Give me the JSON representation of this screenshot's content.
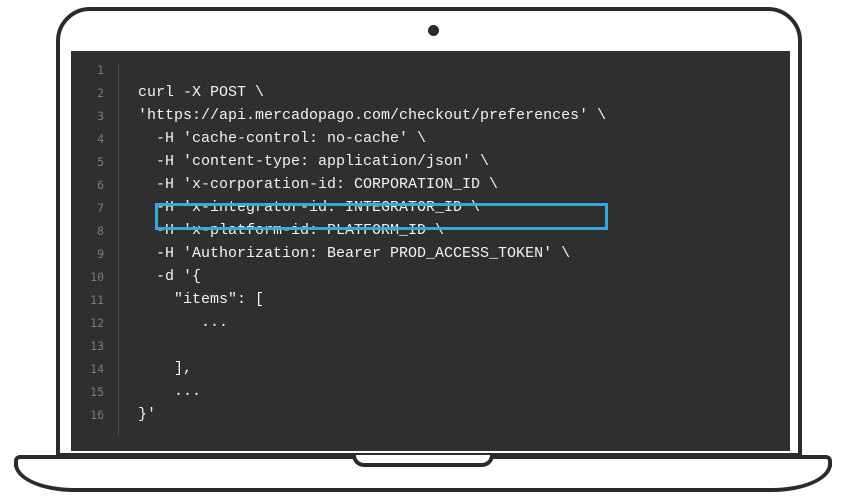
{
  "editor": {
    "line_numbers": [
      "1",
      "2",
      "3",
      "4",
      "5",
      "6",
      "7",
      "8",
      "9",
      "10",
      "11",
      "12",
      "13",
      "14",
      "15",
      "16"
    ],
    "lines": [
      "",
      "curl -X POST \\",
      "'https://api.mercadopago.com/checkout/preferences' \\",
      "  -H 'cache-control: no-cache' \\",
      "  -H 'content-type: application/json' \\",
      "  -H 'x-corporation-id: CORPORATION_ID \\",
      "  -H 'x-integrator-id: INTEGRATOR_ID \\",
      "  -H 'x-platform-id: PLATFORM_ID \\",
      "  -H 'Authorization: Bearer PROD_ACCESS_TOKEN' \\",
      "  -d '{",
      "    \"items\": [",
      "       ...",
      "",
      "    ],",
      "    ...",
      "}'"
    ],
    "highlighted_line": 7,
    "highlight_color": "#3aa7d9",
    "background_color": "#2f2f2f",
    "text_color": "#f2f2f2"
  }
}
